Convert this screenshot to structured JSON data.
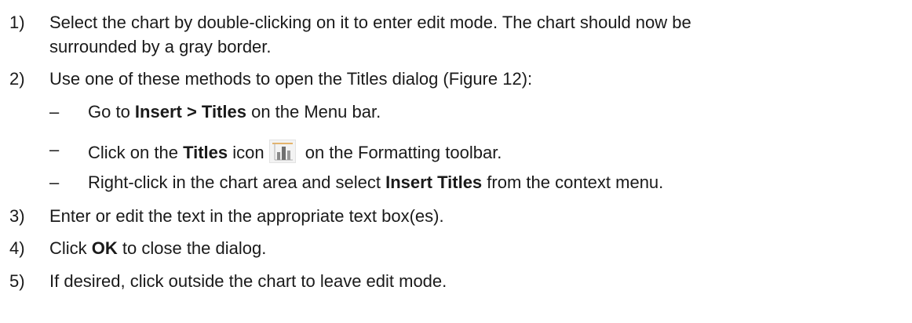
{
  "steps": [
    {
      "num": "1)",
      "line1": "Select the chart by double-clicking on it to enter edit mode. The chart should now be",
      "line2": "surrounded by a gray border."
    },
    {
      "num": "2)",
      "line1": "Use one of these methods to open the Titles dialog (Figure 12):",
      "subs": [
        {
          "dash": "–",
          "pre": "Go to ",
          "bold": "Insert > Titles",
          "post": " on the Menu bar."
        },
        {
          "dash": "–",
          "pre": "Click on the ",
          "bold": "Titles",
          "mid": " icon",
          "icon": "titles-chart-icon",
          "post": " on the Formatting toolbar."
        },
        {
          "dash": "–",
          "pre": "Right-click in the chart area and select ",
          "bold": "Insert Titles",
          "post": " from the context menu."
        }
      ]
    },
    {
      "num": "3)",
      "line1": "Enter or edit the text in the appropriate text box(es)."
    },
    {
      "num": "4)",
      "pre": "Click ",
      "bold": "OK",
      "post": " to close the dialog."
    },
    {
      "num": "5)",
      "line1": "If desired, click outside the chart to leave edit mode."
    }
  ],
  "colors": {
    "text": "#1a1a1a",
    "icon_bars": "#8a8a8a",
    "icon_title_line": "#e0a040"
  }
}
